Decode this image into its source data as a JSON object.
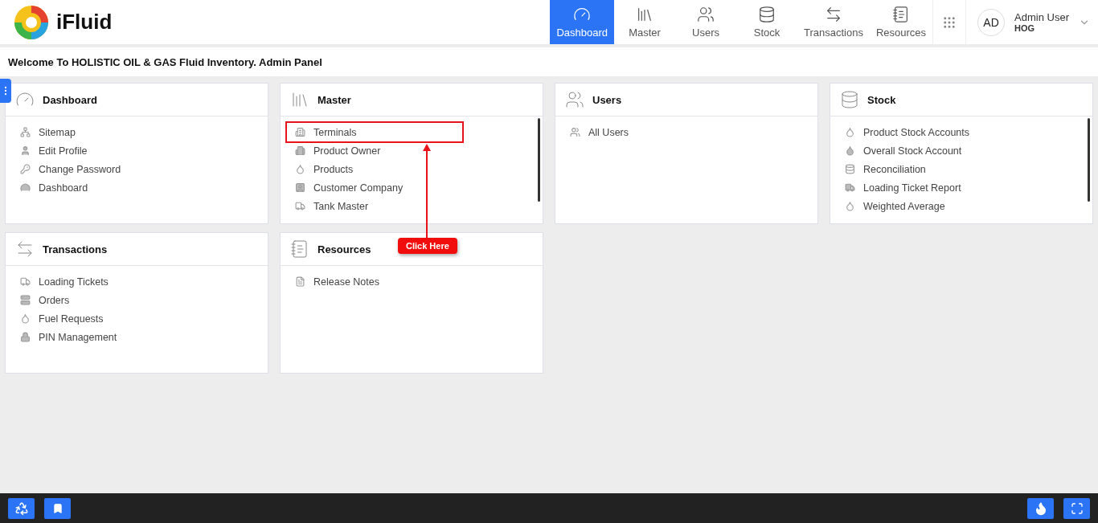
{
  "brand": {
    "name": "iFluid"
  },
  "nav": [
    {
      "label": "Dashboard",
      "selected": true
    },
    {
      "label": "Master",
      "selected": false
    },
    {
      "label": "Users",
      "selected": false
    },
    {
      "label": "Stock",
      "selected": false
    },
    {
      "label": "Transactions",
      "selected": false
    },
    {
      "label": "Resources",
      "selected": false
    }
  ],
  "user": {
    "initials": "AD",
    "name": "Admin User",
    "org": "HOG"
  },
  "welcome": "Welcome To HOLISTIC OIL & GAS Fluid Inventory. Admin Panel",
  "cards": [
    {
      "title": "Dashboard",
      "scrollable": false,
      "items": [
        {
          "label": "Sitemap",
          "highlighted": false
        },
        {
          "label": "Edit Profile",
          "highlighted": false
        },
        {
          "label": "Change Password",
          "highlighted": false
        },
        {
          "label": "Dashboard",
          "highlighted": false
        }
      ]
    },
    {
      "title": "Master",
      "scrollable": true,
      "items": [
        {
          "label": "Terminals",
          "highlighted": true
        },
        {
          "label": "Product Owner",
          "highlighted": false
        },
        {
          "label": "Products",
          "highlighted": false
        },
        {
          "label": "Customer Company",
          "highlighted": false
        },
        {
          "label": "Tank Master",
          "highlighted": false
        }
      ],
      "callout": "Click Here"
    },
    {
      "title": "Users",
      "scrollable": false,
      "items": [
        {
          "label": "All Users",
          "highlighted": false
        }
      ]
    },
    {
      "title": "Stock",
      "scrollable": true,
      "items": [
        {
          "label": "Product Stock Accounts",
          "highlighted": false
        },
        {
          "label": "Overall Stock Account",
          "highlighted": false
        },
        {
          "label": "Reconciliation",
          "highlighted": false
        },
        {
          "label": "Loading Ticket Report",
          "highlighted": false
        },
        {
          "label": "Weighted Average",
          "highlighted": false
        }
      ]
    },
    {
      "title": "Transactions",
      "scrollable": false,
      "items": [
        {
          "label": "Loading Tickets",
          "highlighted": false
        },
        {
          "label": "Orders",
          "highlighted": false
        },
        {
          "label": "Fuel Requests",
          "highlighted": false
        },
        {
          "label": "PIN Management",
          "highlighted": false
        }
      ]
    },
    {
      "title": "Resources",
      "scrollable": false,
      "items": [
        {
          "label": "Release Notes",
          "highlighted": false
        }
      ]
    }
  ]
}
